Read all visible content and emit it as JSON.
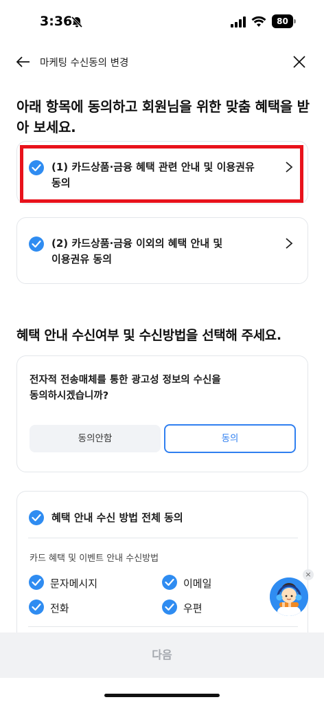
{
  "status_bar": {
    "time": "3:36",
    "battery": "80"
  },
  "header": {
    "title": "마케팅 수신동의 변경"
  },
  "headline": "아래 항목에 동의하고 회원님을 위한 맞춤 혜택을 받아 보세요.",
  "agreements": [
    {
      "line1": "(1) 카드상품·금융 혜택 관련 안내 및 이용권유",
      "line2": "동의",
      "checked": true
    },
    {
      "line1": "(2) 카드상품·금융 이외의 혜택 안내 및",
      "line2": "이용권유 동의",
      "checked": true
    }
  ],
  "section_title": "혜택 안내 수신여부 및 수신방법을 선택해 주세요.",
  "consent": {
    "question_line1": "전자적 전송매체를 통한 광고성 정보의 수신을",
    "question_line2": "동의하시겠습니까?",
    "decline_label": "동의안함",
    "agree_label": "동의",
    "selected": "agree"
  },
  "methods": {
    "all_label": "혜택 안내 수신 방법 전체 동의",
    "subtitle": "카드 혜택 및 이벤트 안내 수신방법",
    "items": [
      {
        "label": "문자메시지",
        "checked": true
      },
      {
        "label": "이메일",
        "checked": true
      },
      {
        "label": "전화",
        "checked": true
      },
      {
        "label": "우편",
        "checked": true
      }
    ]
  },
  "mascot_close": "×",
  "next_button": "다음",
  "colors": {
    "accent": "#2f8cf1",
    "highlight": "#e8121b",
    "disabled_text": "#a4a8ae"
  }
}
